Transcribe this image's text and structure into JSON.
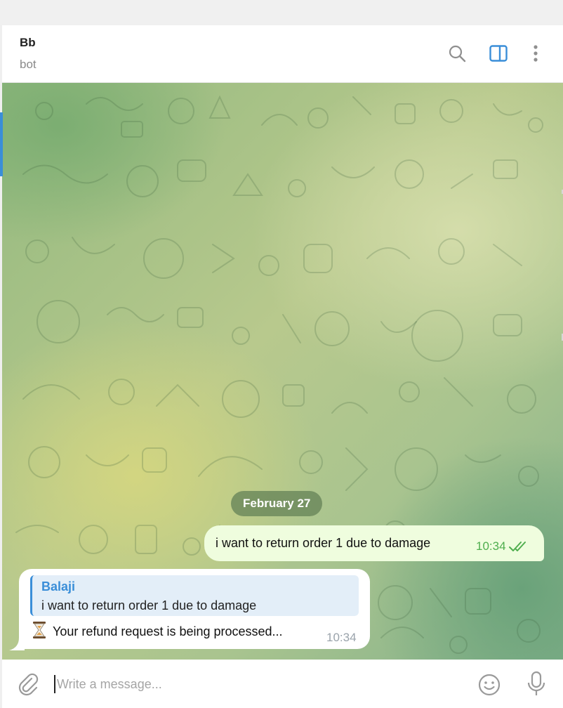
{
  "header": {
    "title": "Bb",
    "subtitle": "bot",
    "icons": [
      "search-icon",
      "sidebar-toggle-icon",
      "more-vertical-icon"
    ],
    "accent_color": "#3a8ed8"
  },
  "chat": {
    "date_separator": "February 27",
    "messages": [
      {
        "direction": "outgoing",
        "text": "i want to return order 1 due to damage",
        "time": "10:34",
        "status": "read",
        "bubble_color": "#effdde"
      },
      {
        "direction": "incoming",
        "reply_to": {
          "author": "Balaji",
          "text": "i want to return order 1 due to damage"
        },
        "prefix_icon": "hourglass-icon",
        "text": "Your refund request is being processed...",
        "time": "10:34",
        "bubble_color": "#ffffff"
      }
    ]
  },
  "composer": {
    "placeholder": "Write a message...",
    "value": "",
    "icons": [
      "paperclip-icon",
      "emoji-icon",
      "microphone-icon"
    ]
  }
}
